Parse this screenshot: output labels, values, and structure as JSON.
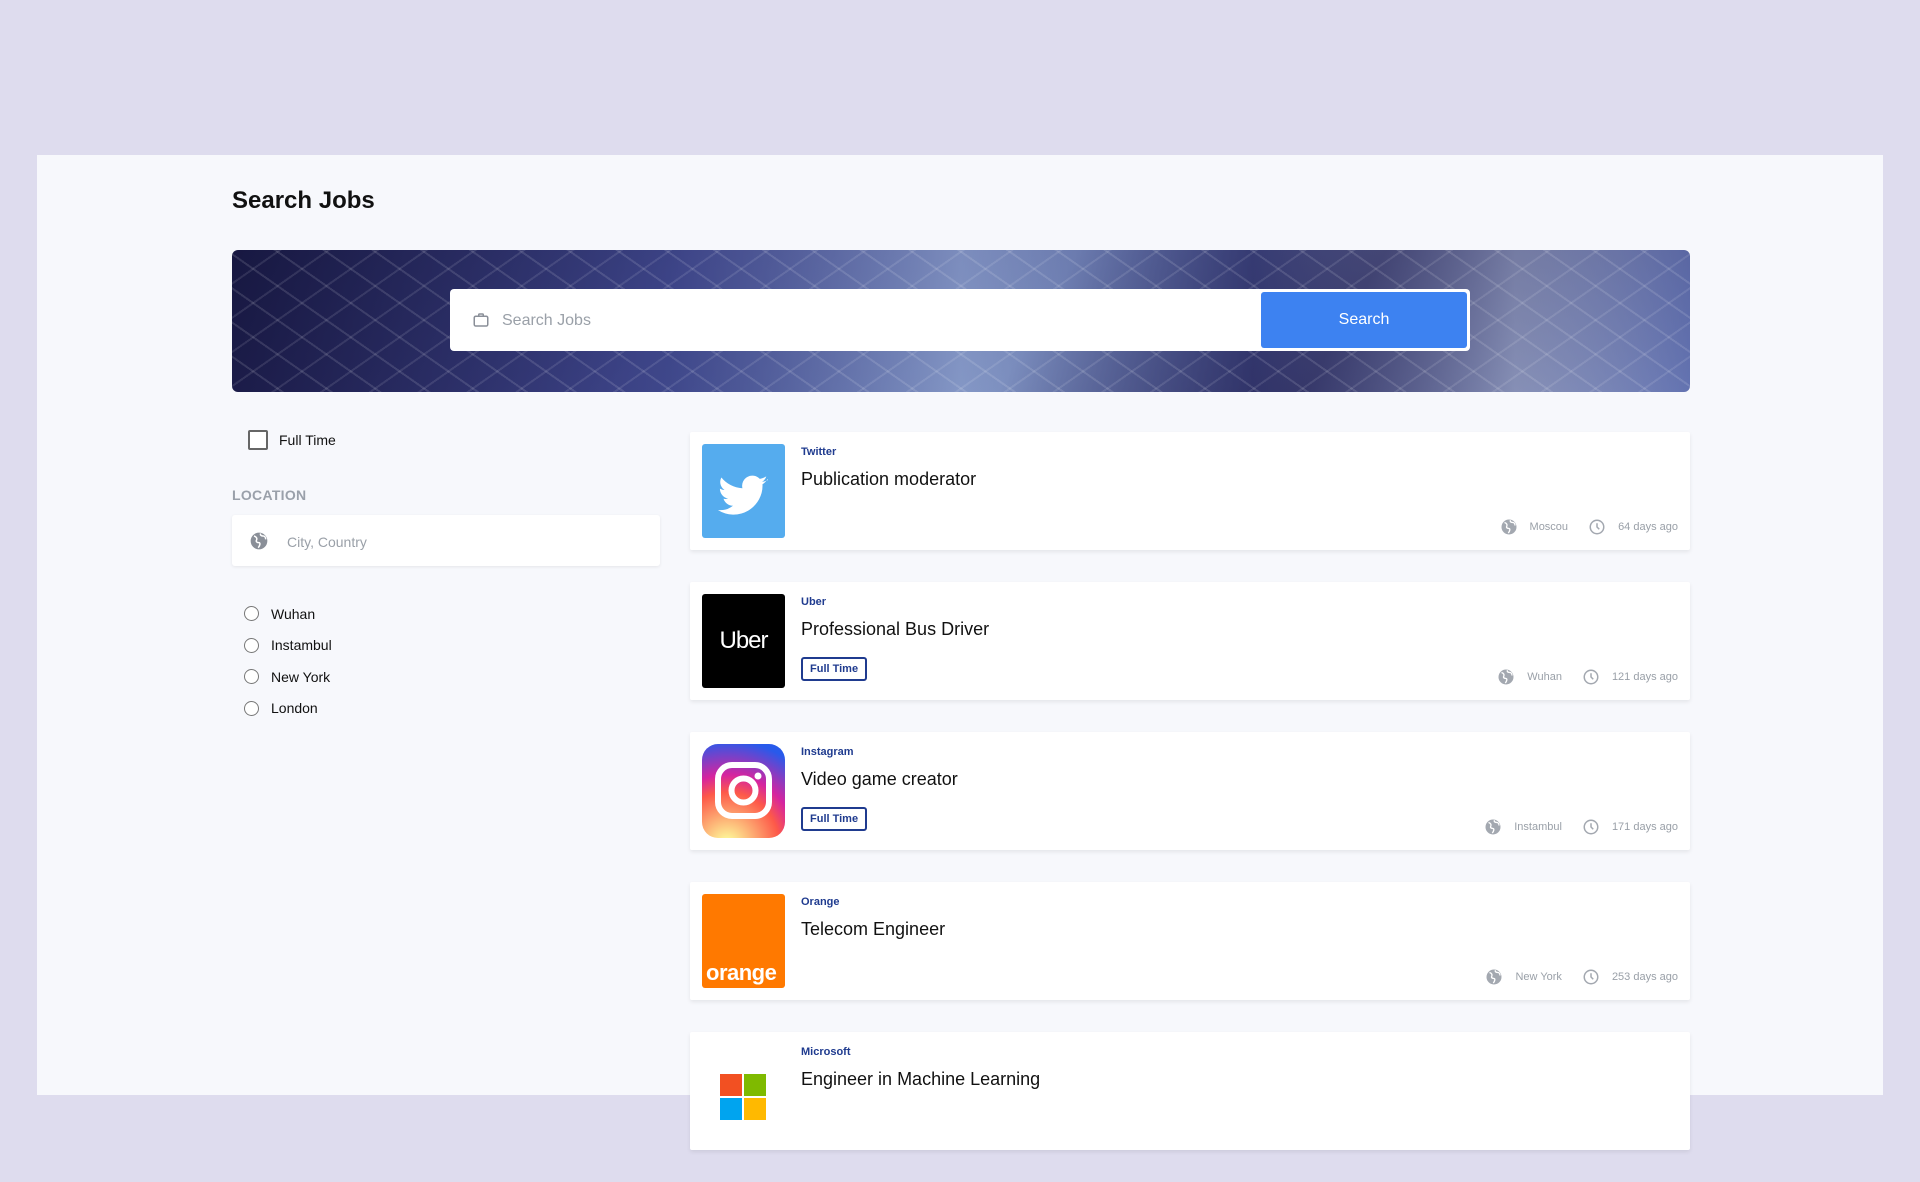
{
  "page": {
    "title": "Search Jobs"
  },
  "search": {
    "placeholder": "Search Jobs",
    "button_label": "Search"
  },
  "filters": {
    "full_time_label": "Full Time",
    "location_label": "LOCATION",
    "location_placeholder": "City, Country",
    "cities": [
      "Wuhan",
      "Instambul",
      "New York",
      "London"
    ]
  },
  "jobs": [
    {
      "company": "Twitter",
      "title": "Publication moderator",
      "tag": "",
      "location": "Moscou",
      "posted": "64 days ago",
      "logo": "twitter-logo"
    },
    {
      "company": "Uber",
      "title": "Professional Bus Driver",
      "tag": "Full Time",
      "location": "Wuhan",
      "posted": "121 days ago",
      "logo": "uber-logo",
      "logo_text": "Uber"
    },
    {
      "company": "Instagram",
      "title": "Video game creator",
      "tag": "Full Time",
      "location": "Instambul",
      "posted": "171 days ago",
      "logo": "instagram-logo"
    },
    {
      "company": "Orange",
      "title": "Telecom Engineer",
      "tag": "",
      "location": "New York",
      "posted": "253 days ago",
      "logo": "orange-logo",
      "logo_text": "orange"
    },
    {
      "company": "Microsoft",
      "title": "Engineer in Machine Learning",
      "tag": "",
      "location": "",
      "posted": "",
      "logo": "microsoft-logo"
    }
  ],
  "colors": {
    "accent": "#3d82f1",
    "company": "#1f3b8f",
    "background": "#dedcee",
    "page": "#f7f8fc"
  }
}
